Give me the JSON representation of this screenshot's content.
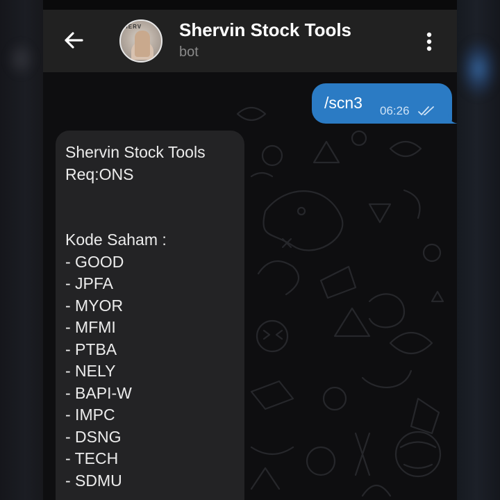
{
  "header": {
    "title": "Shervin Stock Tools",
    "subtitle": "bot"
  },
  "outgoing": {
    "text": "/scn3",
    "time": "06:26",
    "status": "read"
  },
  "incoming": {
    "lines": [
      "Shervin Stock Tools",
      "Req:ONS",
      "",
      "",
      "Kode Saham :",
      "- GOOD",
      "- JPFA",
      "- MYOR",
      "- MFMI",
      "- PTBA",
      "- NELY",
      "- BAPI-W",
      "- IMPC",
      "- DSNG",
      "- TECH",
      "- SDMU"
    ]
  },
  "colors": {
    "header_bg": "#212121",
    "chat_bg": "#0e0e10",
    "outgoing_bubble": "#2b7bc4",
    "incoming_bubble": "#232325"
  },
  "icons": {
    "back": "arrow-left-icon",
    "menu": "more-vertical-icon",
    "status": "double-check-icon"
  }
}
